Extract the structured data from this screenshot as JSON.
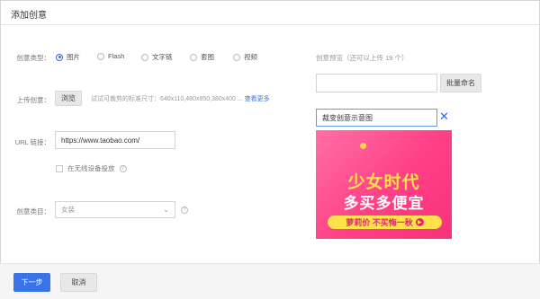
{
  "dialog": {
    "title": "添加创意"
  },
  "creative_type": {
    "label": "创意类型：",
    "options": [
      "图片",
      "Flash",
      "文字链",
      "套图",
      "视频"
    ],
    "selected": "图片"
  },
  "upload": {
    "label": "上传创意：",
    "button_label": "浏览",
    "hint": "试试可裁剪的标准尺寸：640x110,480x850,380x400 ...",
    "more_link": "查看更多"
  },
  "url": {
    "label": "URL 链接：",
    "value": "https://www.taobao.com/",
    "wireless_checkbox_label": "在无线设备投放",
    "wireless_checked": false
  },
  "category": {
    "label": "创意类目：",
    "selected": "女装"
  },
  "preview": {
    "title": "创意预览（还可以上传 19 个）",
    "batch_input_value": "",
    "batch_button_label": "批量命名",
    "name_input_value": "裁变创意示意图",
    "banner": {
      "line1": "少女时代",
      "line2": "多买多便宜",
      "cta": "萝莉价 不买悔一秋",
      "play_icon": "play-icon"
    }
  },
  "footer": {
    "next_label": "下一步",
    "cancel_label": "取消"
  },
  "colors": {
    "accent": "#3a73e8",
    "banner_pink": "#ff3f86",
    "banner_yellow": "#ffe24a"
  }
}
